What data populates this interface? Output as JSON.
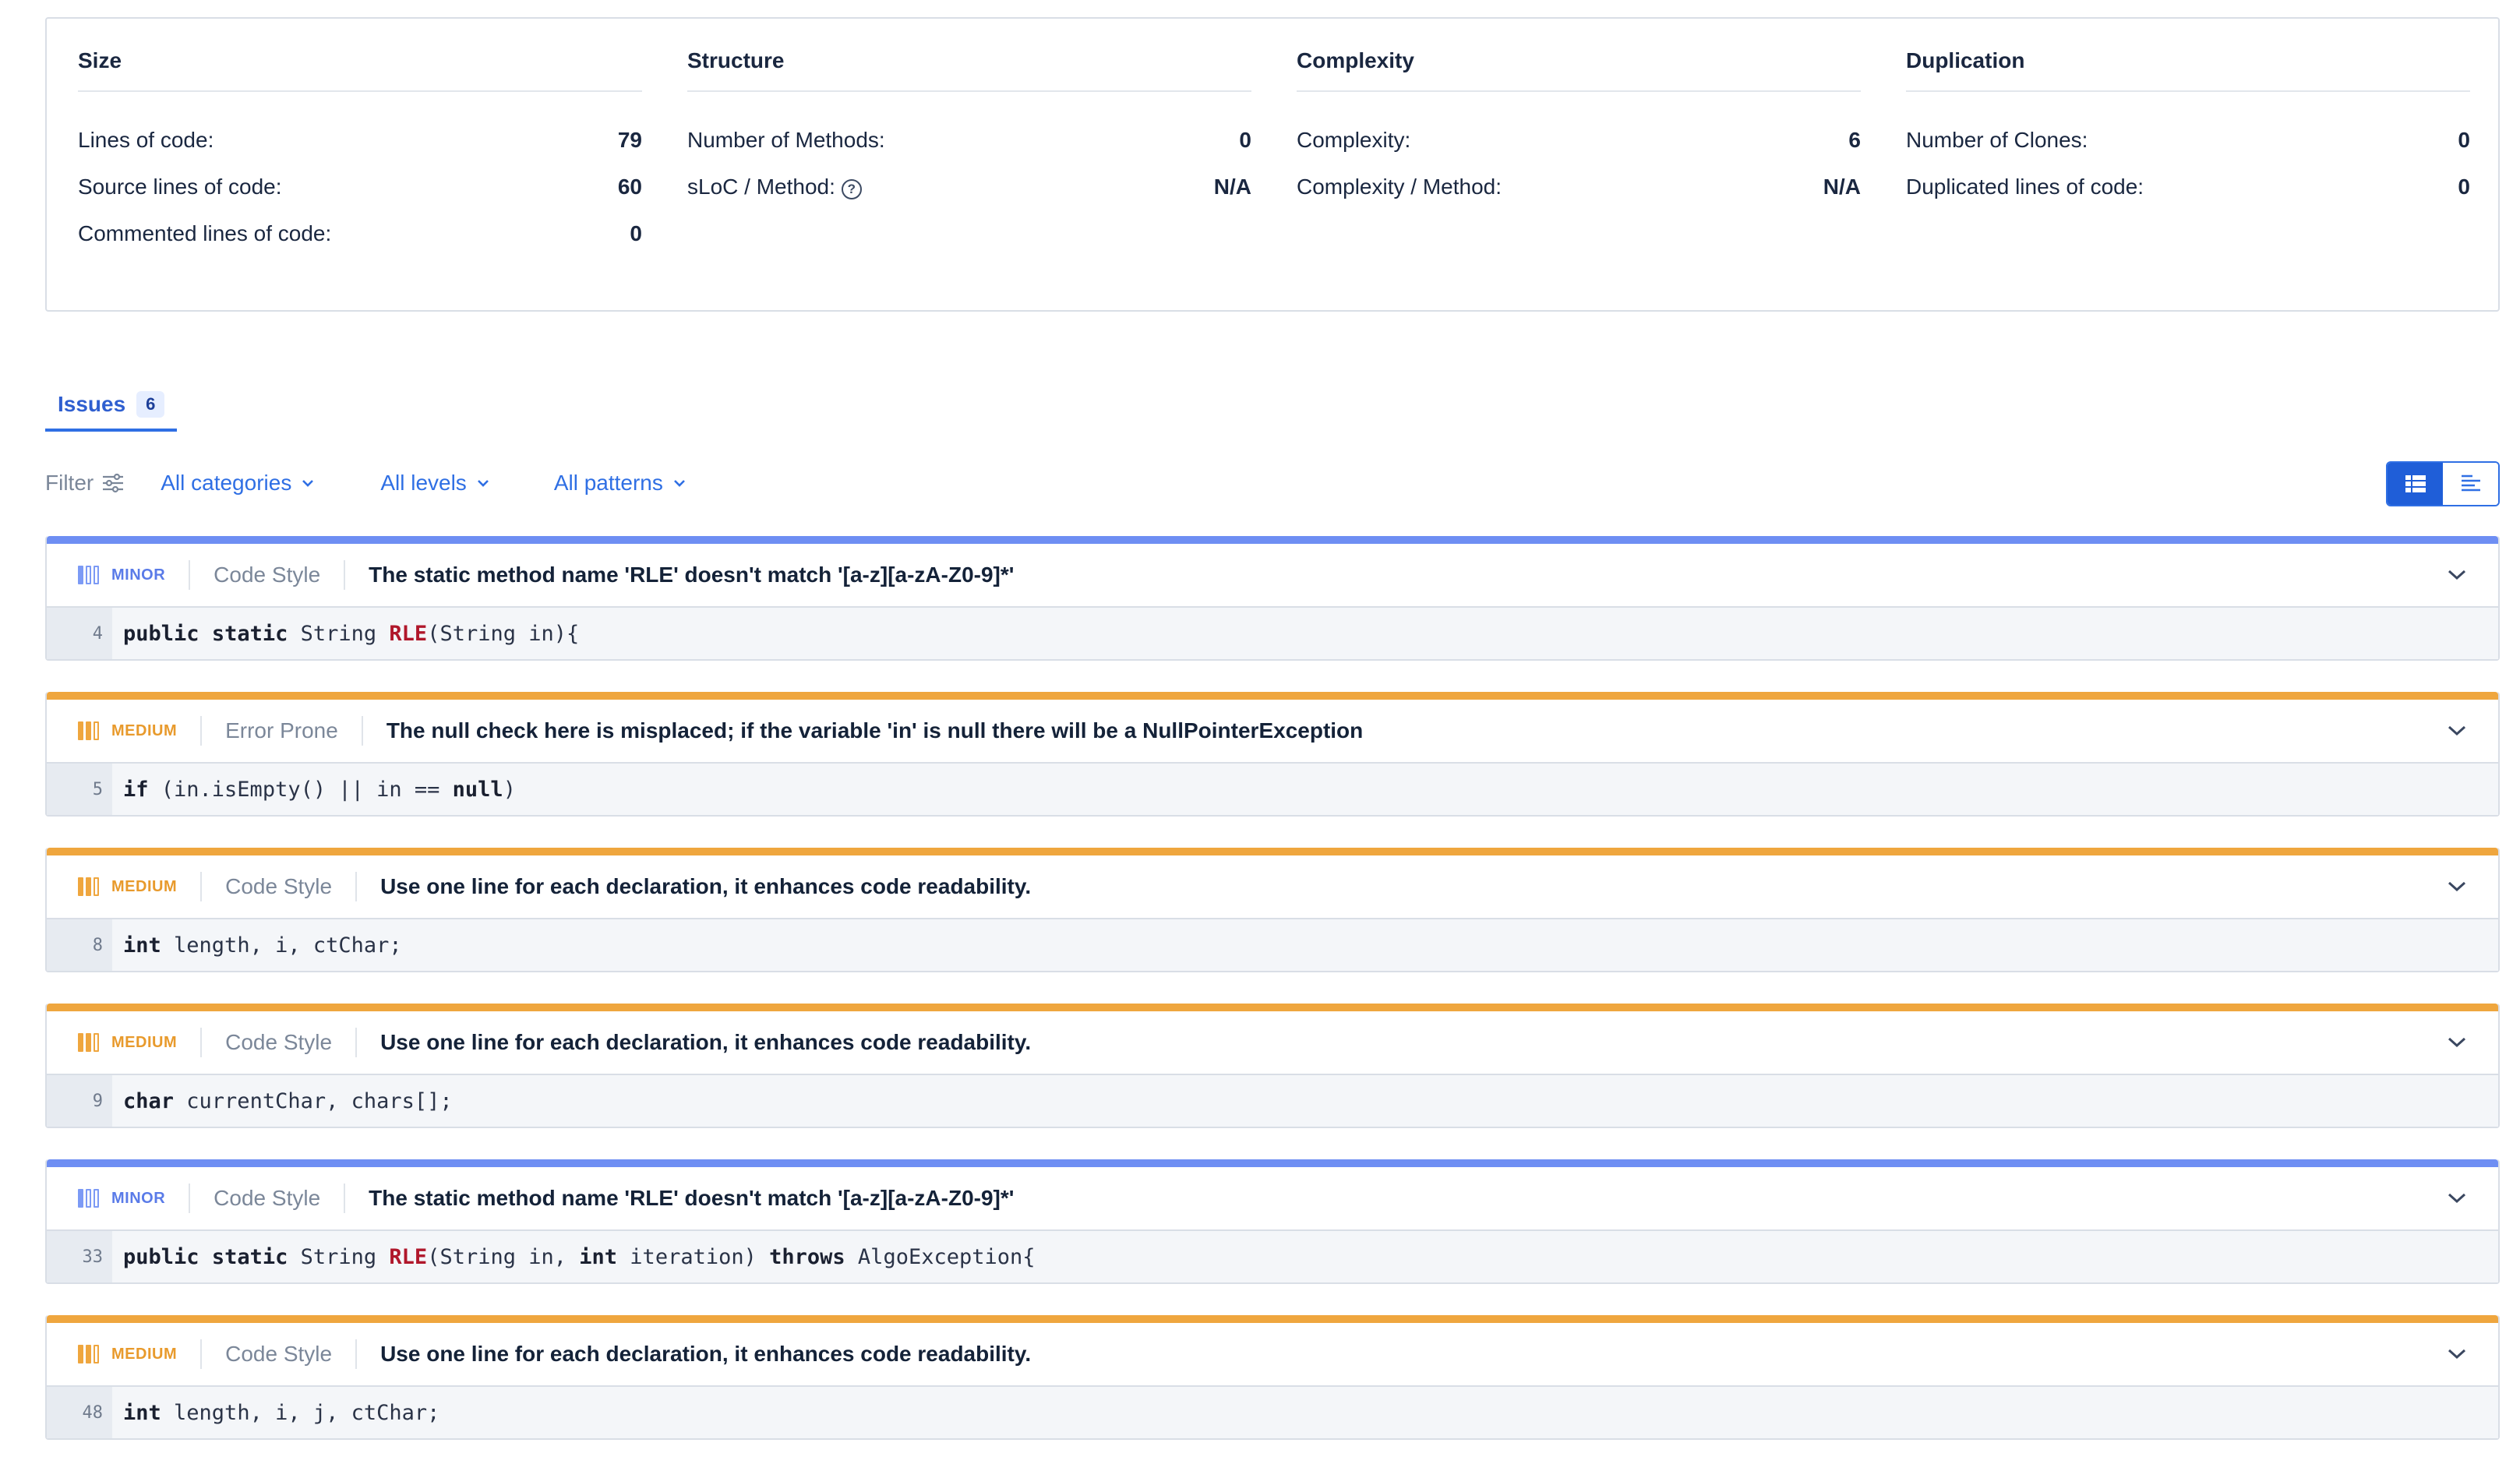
{
  "metrics": {
    "size": {
      "title": "Size",
      "rows": [
        {
          "label": "Lines of code:",
          "value": "79"
        },
        {
          "label": "Source lines of code:",
          "value": "60"
        },
        {
          "label": "Commented lines of code:",
          "value": "0"
        }
      ]
    },
    "structure": {
      "title": "Structure",
      "rows": [
        {
          "label": "Number of Methods:",
          "value": "0"
        },
        {
          "label": "sLoC / Method:",
          "value": "N/A",
          "icon": "help-circle-icon"
        }
      ]
    },
    "complexity": {
      "title": "Complexity",
      "rows": [
        {
          "label": "Complexity:",
          "value": "6"
        },
        {
          "label": "Complexity / Method:",
          "value": "N/A"
        }
      ]
    },
    "duplication": {
      "title": "Duplication",
      "rows": [
        {
          "label": "Number of Clones:",
          "value": "0"
        },
        {
          "label": "Duplicated lines of code:",
          "value": "0"
        }
      ]
    }
  },
  "tabs": {
    "issues_label": "Issues",
    "issues_count": "6"
  },
  "filters": {
    "filter_label": "Filter",
    "categories": "All categories",
    "levels": "All levels",
    "patterns": "All patterns"
  },
  "colors": {
    "accent": "#2f6fe4",
    "minor": "#6e8ef3",
    "medium": "#efa63e"
  },
  "issues": [
    {
      "level": "MINOR",
      "category": "Code Style",
      "message": "The static method name 'RLE' doesn't match '[a-z][a-zA-Z0-9]*'",
      "line": "4",
      "code": [
        [
          "kw",
          "public"
        ],
        [
          "t",
          " "
        ],
        [
          "kw",
          "static"
        ],
        [
          "t",
          " String "
        ],
        [
          "fn",
          "RLE"
        ],
        [
          "t",
          "(String in){"
        ]
      ]
    },
    {
      "level": "MEDIUM",
      "category": "Error Prone",
      "message": "The null check here is misplaced; if the variable 'in' is null there will be a NullPointerException",
      "line": "5",
      "code": [
        [
          "kw",
          "if"
        ],
        [
          "t",
          " (in.isEmpty() || in == "
        ],
        [
          "kw",
          "null"
        ],
        [
          "t",
          ")"
        ]
      ]
    },
    {
      "level": "MEDIUM",
      "category": "Code Style",
      "message": "Use one line for each declaration, it enhances code readability.",
      "line": "8",
      "code": [
        [
          "kw",
          "int"
        ],
        [
          "t",
          " length, i, ctChar;"
        ]
      ]
    },
    {
      "level": "MEDIUM",
      "category": "Code Style",
      "message": "Use one line for each declaration, it enhances code readability.",
      "line": "9",
      "code": [
        [
          "kw",
          "char"
        ],
        [
          "t",
          " currentChar, chars[];"
        ]
      ]
    },
    {
      "level": "MINOR",
      "category": "Code Style",
      "message": "The static method name 'RLE' doesn't match '[a-z][a-zA-Z0-9]*'",
      "line": "33",
      "code": [
        [
          "kw",
          "public"
        ],
        [
          "t",
          " "
        ],
        [
          "kw",
          "static"
        ],
        [
          "t",
          " String "
        ],
        [
          "fn",
          "RLE"
        ],
        [
          "t",
          "(String in, "
        ],
        [
          "kw",
          "int"
        ],
        [
          "t",
          " iteration) "
        ],
        [
          "kw",
          "throws"
        ],
        [
          "t",
          " AlgoException{"
        ]
      ]
    },
    {
      "level": "MEDIUM",
      "category": "Code Style",
      "message": "Use one line for each declaration, it enhances code readability.",
      "line": "48",
      "code": [
        [
          "kw",
          "int"
        ],
        [
          "t",
          " length, i, j, ctChar;"
        ]
      ]
    }
  ]
}
